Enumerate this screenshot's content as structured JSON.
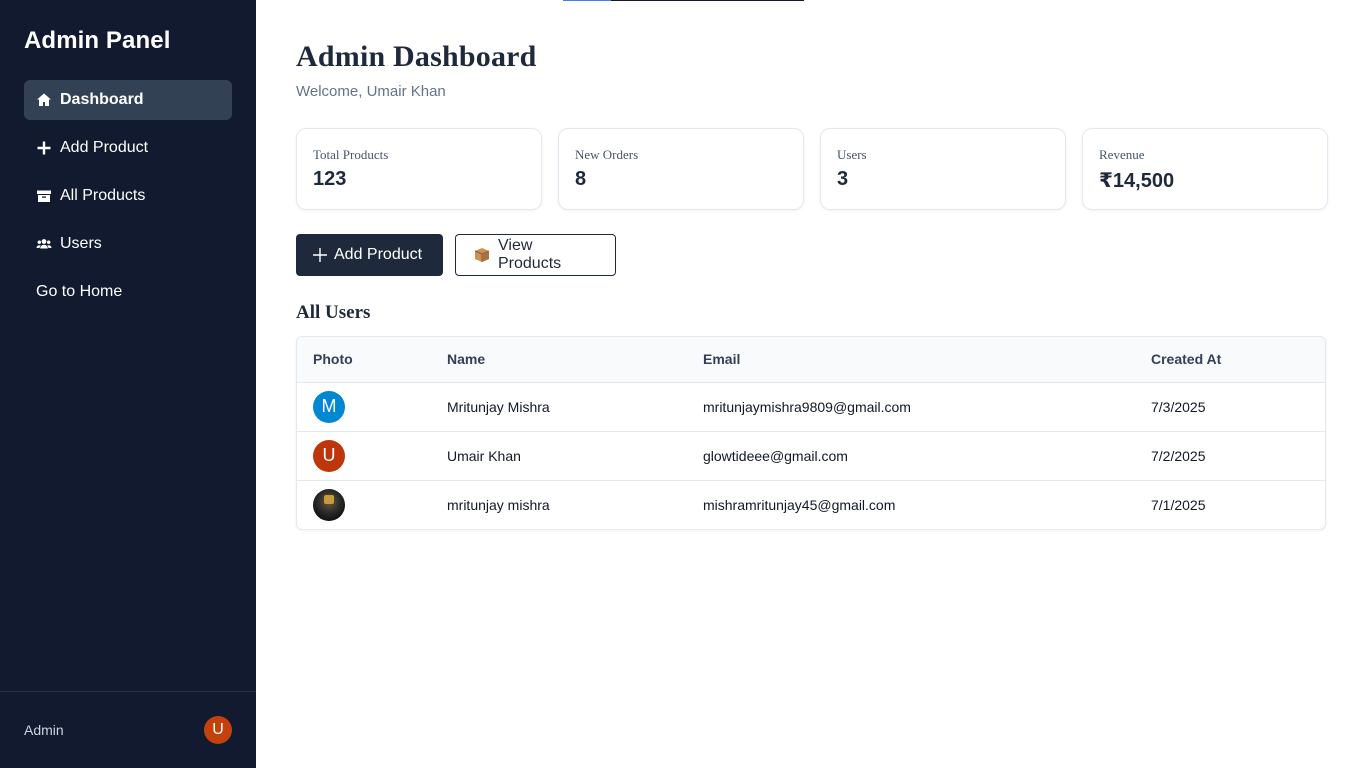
{
  "sidebar": {
    "brand": "Admin Panel",
    "items": [
      {
        "label": "Dashboard",
        "icon": "home-icon",
        "active": true
      },
      {
        "label": "Add Product",
        "icon": "plus-icon"
      },
      {
        "label": "All Products",
        "icon": "box-icon"
      },
      {
        "label": "Users",
        "icon": "users-icon"
      },
      {
        "label": "Go to Home",
        "icon": ""
      }
    ],
    "footer": {
      "role": "Admin",
      "avatar_initial": "U",
      "avatar_color": "#c2410c"
    }
  },
  "header": {
    "title": "Admin Dashboard",
    "welcome": "Welcome, Umair Khan"
  },
  "stats": [
    {
      "label": "Total Products",
      "value": "123"
    },
    {
      "label": "New Orders",
      "value": "8"
    },
    {
      "label": "Users",
      "value": "3"
    },
    {
      "label": "Revenue",
      "value": "₹14,500"
    }
  ],
  "actions": {
    "add_product": "Add Product",
    "view_products": "View Products"
  },
  "users_table": {
    "title": "All Users",
    "columns": [
      "Photo",
      "Name",
      "Email",
      "Created At"
    ],
    "rows": [
      {
        "initial": "M",
        "avatar_color": "#0288d1",
        "name": "Mritunjay Mishra",
        "email": "mritunjaymishra9809@gmail.com",
        "created": "7/3/2025"
      },
      {
        "initial": "U",
        "avatar_color": "#bf360c",
        "name": "Umair Khan",
        "email": "glowtideee@gmail.com",
        "created": "7/2/2025"
      },
      {
        "initial": "",
        "avatar_color": "#222222",
        "name": "mritunjay mishra",
        "email": "mishramritunjay45@gmail.com",
        "created": "7/1/2025"
      }
    ]
  },
  "colors": {
    "sidebar_bg": "#111a2e",
    "active_item_bg": "#334155",
    "primary_dark": "#1e293b"
  }
}
